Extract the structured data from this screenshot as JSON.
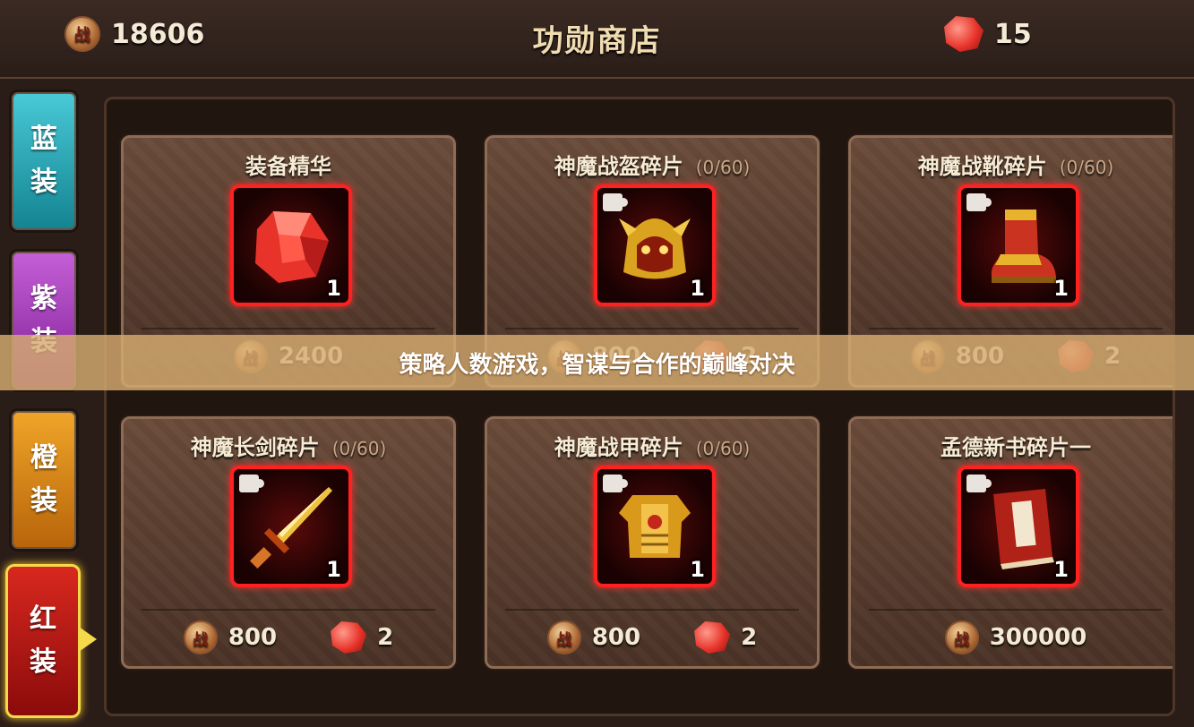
{
  "header": {
    "title": "功勋商店",
    "merit_amount": "18606",
    "gem_amount": "15",
    "coin_glyph": "战"
  },
  "tabs": [
    {
      "line1": "蓝",
      "line2": "装",
      "color": "#1faab8"
    },
    {
      "line1": "紫",
      "line2": "装",
      "color": "#a43bbd"
    },
    {
      "line1": "橙",
      "line2": "装",
      "color": "#dd8a18"
    },
    {
      "line1": "红",
      "line2": "装",
      "color": "#c01a14",
      "selected": true
    }
  ],
  "items": [
    {
      "name": "装备精华",
      "progress": "",
      "qty": "1",
      "icon": "red-gem-icon",
      "merit_price": "2400",
      "gem_price": ""
    },
    {
      "name": "神魔战盔碎片",
      "progress": "(0/60)",
      "qty": "1",
      "icon": "golden-helmet-icon",
      "merit_price": "800",
      "gem_price": "2"
    },
    {
      "name": "神魔战靴碎片",
      "progress": "(0/60)",
      "qty": "1",
      "icon": "golden-boots-icon",
      "merit_price": "800",
      "gem_price": "2"
    },
    {
      "name": "神魔长剑碎片",
      "progress": "(0/60)",
      "qty": "1",
      "icon": "golden-sword-icon",
      "merit_price": "800",
      "gem_price": "2"
    },
    {
      "name": "神魔战甲碎片",
      "progress": "(0/60)",
      "qty": "1",
      "icon": "golden-armor-icon",
      "merit_price": "800",
      "gem_price": "2"
    },
    {
      "name": "孟德新书碎片一",
      "progress": "",
      "qty": "1",
      "icon": "book-icon",
      "merit_price": "300000",
      "gem_price": ""
    }
  ],
  "banner": {
    "text": "策略人数游戏，智谋与合作的巅峰对决"
  }
}
